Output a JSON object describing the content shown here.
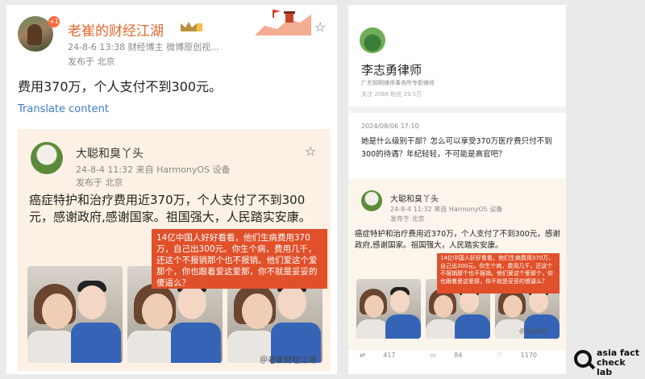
{
  "left_post": {
    "author": "老崔的财经江湖",
    "notification_count": "+1",
    "meta_line": "24-8-6 13:38  财经博主 微博原创视...",
    "location": "发布于 北京",
    "text": "费用370万，个人支付不到300元。",
    "translate_label": "Translate content",
    "quote": {
      "author": "大聪和臭丫头",
      "meta_line": "24-8-4 11:32  来自 HarmonyOS 设备",
      "location": "发布于 北京",
      "text": "癌症特护和治疗费用近370万，个人支付了不到300元，感谢政府,感谢国家。祖国强大，人民踏实安康。",
      "overlay_text": "14亿中国人好好看看，他们生病费用370万，自己出300元。你生个病，费用几千，还这个不报销那个也不报销。他们爱这个爱那个，你也跟着爱这爱那，你不就是妥妥的傻逼么？",
      "watermark": "＠老崔财经江湖"
    }
  },
  "right_post": {
    "author": "李志勇律师",
    "firm": "广东知明律师事务所专职律师",
    "stats": "关注 2086    粉丝 29.5万",
    "date": "2024/08/06 17:10",
    "text": "她是什么级别干部？怎么可以享受370万医疗费只付不到300的待遇？年纪轻轻，不可能是高官吧？",
    "quote": {
      "author": "大聪和臭丫头",
      "meta_line": "24-8-4 11:32  来自 HarmonyOS 设备",
      "location": "发布于 北京",
      "text": "癌症特护和治疗费用近370万，个人支付了不到300元，感谢政府,感谢国家。祖国强大，人民踏实安康。",
      "overlay_text": "14亿中国人好好看看，他们生病费用370万，自己出300元。你生个病，费用几千，还这个不报销那个也不报销。他们爱这个爱那个，你也跟着爱这爱那，你不就是妥妥的傻逼么？",
      "watermark": "＠李志勇律"
    },
    "actions": {
      "reposts": "417",
      "comments": "84",
      "likes": "1170"
    }
  },
  "logo": {
    "line1": "asia fact",
    "line2": "check lab"
  },
  "icons": {
    "star": "star-icon",
    "repost": "repost-icon",
    "comment": "comment-icon",
    "like": "like-icon"
  },
  "colors": {
    "author_orange": "#e8642a",
    "link_blue": "#3b7cc4",
    "overlay_red": "#e0502a",
    "quote_bg": "#fcf1e4"
  }
}
